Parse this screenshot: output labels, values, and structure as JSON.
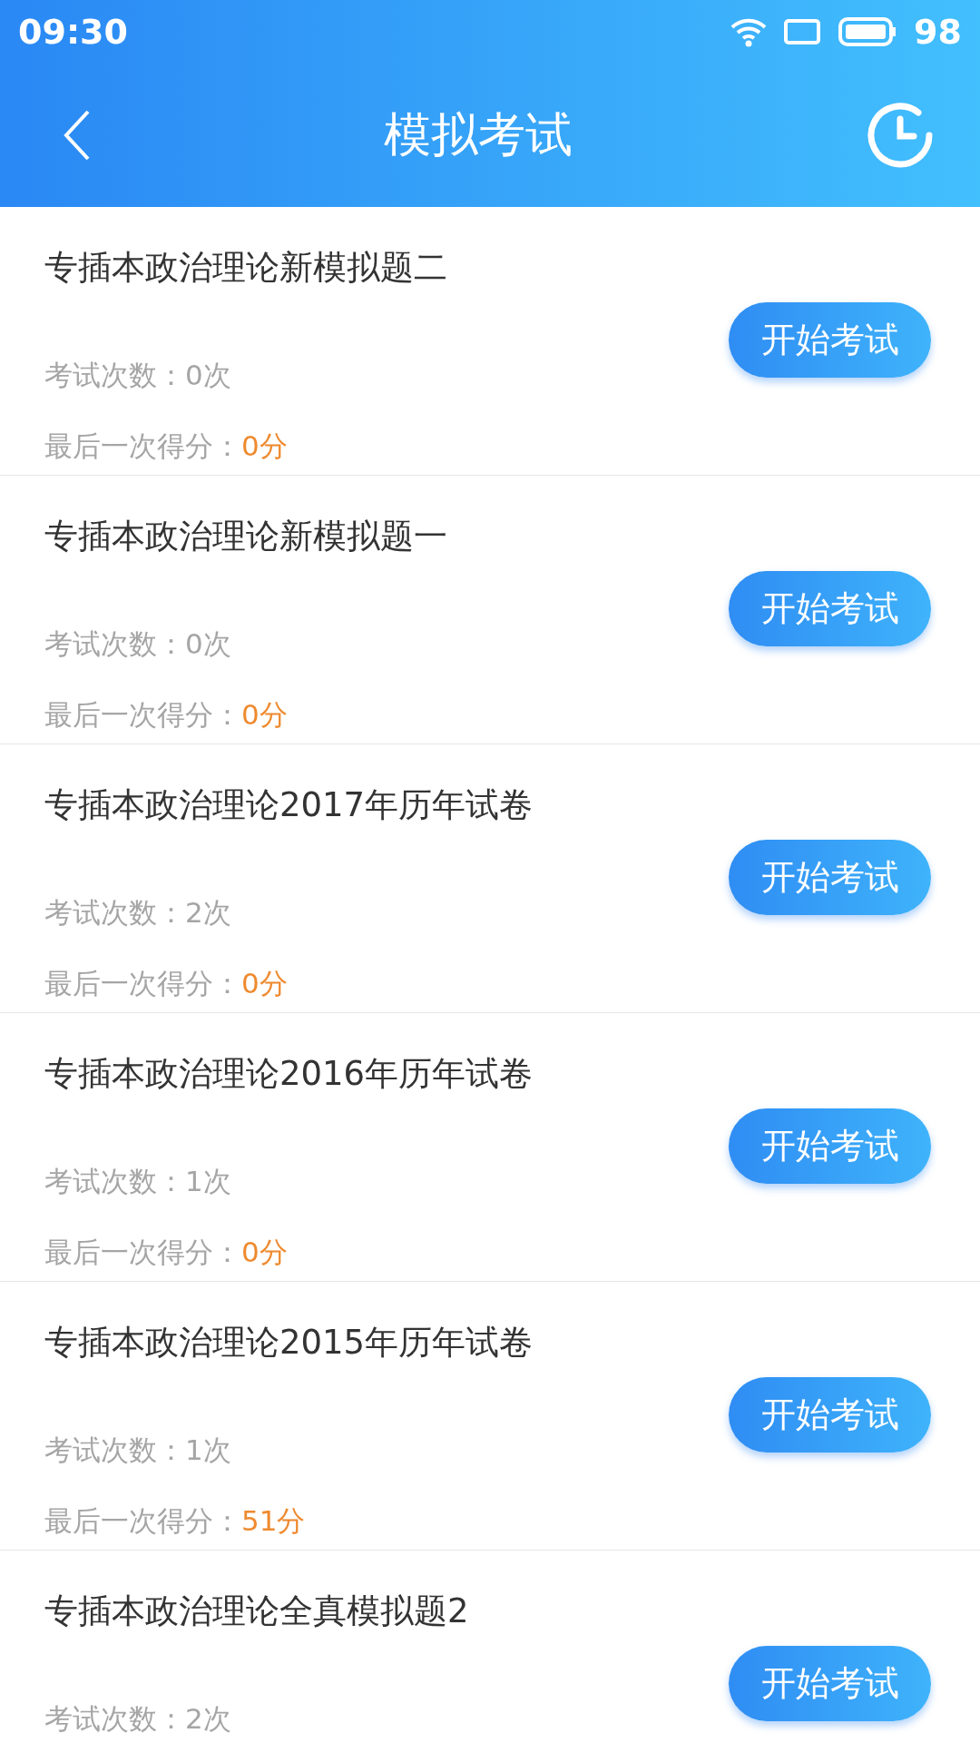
{
  "status_bar": {
    "time": "09:30",
    "battery": "98"
  },
  "header": {
    "title": "模拟考试"
  },
  "exams": [
    {
      "title": "专插本政治理论新模拟题二",
      "attempts": "考试次数：0次",
      "score_label": "最后一次得分：",
      "score": "0分",
      "button": "开始考试"
    },
    {
      "title": "专插本政治理论新模拟题一",
      "attempts": "考试次数：0次",
      "score_label": "最后一次得分：",
      "score": "0分",
      "button": "开始考试"
    },
    {
      "title": "专插本政治理论2017年历年试卷",
      "attempts": "考试次数：2次",
      "score_label": "最后一次得分：",
      "score": "0分",
      "button": "开始考试"
    },
    {
      "title": "专插本政治理论2016年历年试卷",
      "attempts": "考试次数：1次",
      "score_label": "最后一次得分：",
      "score": "0分",
      "button": "开始考试"
    },
    {
      "title": "专插本政治理论2015年历年试卷",
      "attempts": "考试次数：1次",
      "score_label": "最后一次得分：",
      "score": "51分",
      "button": "开始考试"
    },
    {
      "title": "专插本政治理论全真模拟题2",
      "attempts": "考试次数：2次",
      "button": "开始考试"
    }
  ]
}
